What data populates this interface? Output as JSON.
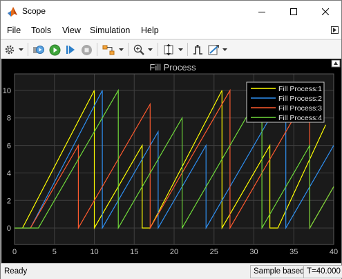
{
  "window": {
    "title": "Scope",
    "buttons": [
      "minimize",
      "maximize",
      "close"
    ]
  },
  "menu": [
    "File",
    "Tools",
    "View",
    "Simulation",
    "Help"
  ],
  "toolbar": [
    "settings-icon",
    "dropdown-icon",
    "restore-icon",
    "run-icon",
    "step-forward-icon",
    "stop-icon",
    "highlight-icon",
    "dropdown-icon",
    "zoom-icon",
    "dropdown-icon",
    "autoscale-icon",
    "dropdown-icon",
    "triggers-icon",
    "cursor-measurement-icon",
    "dropdown-icon"
  ],
  "status": {
    "left": "Ready",
    "mode": "Sample based",
    "time": "T=40.000"
  },
  "colors": {
    "background": "#000000",
    "axes": "#1a1a1a",
    "grid": "#404040",
    "text": "#c8c8c8",
    "series": [
      "#ffff00",
      "#2e8ff2",
      "#ff5a2e",
      "#6fd93a"
    ]
  },
  "chart_data": {
    "type": "line",
    "title": "Fill Process",
    "xlim": [
      0,
      40
    ],
    "ylim": [
      -1.2,
      11.2
    ],
    "xticks": [
      0,
      5,
      10,
      15,
      20,
      25,
      30,
      35,
      40
    ],
    "yticks": [
      0,
      2,
      4,
      6,
      8,
      10
    ],
    "grid": true,
    "legend_position": "top-right",
    "series": [
      {
        "name": "Fill Process:1",
        "color": "#ffff00",
        "points": [
          [
            0,
            0
          ],
          [
            1,
            0
          ],
          [
            10,
            10
          ],
          [
            10,
            0
          ],
          [
            16,
            6
          ],
          [
            16,
            0
          ],
          [
            17,
            0
          ],
          [
            26,
            10
          ],
          [
            26,
            0
          ],
          [
            32,
            6
          ],
          [
            32,
            0
          ],
          [
            33,
            0
          ],
          [
            39,
            7.5
          ]
        ]
      },
      {
        "name": "Fill Process:2",
        "color": "#2e8ff2",
        "points": [
          [
            0,
            0
          ],
          [
            2,
            0
          ],
          [
            11,
            10
          ],
          [
            11,
            0
          ],
          [
            18,
            7
          ],
          [
            18,
            0
          ],
          [
            24,
            6
          ],
          [
            24,
            0
          ],
          [
            34,
            10
          ],
          [
            34,
            0
          ],
          [
            40,
            6
          ]
        ]
      },
      {
        "name": "Fill Process:3",
        "color": "#ff5a2e",
        "points": [
          [
            0,
            0
          ],
          [
            2,
            0
          ],
          [
            8,
            6
          ],
          [
            8,
            0
          ],
          [
            17,
            9
          ],
          [
            17,
            0
          ],
          [
            27,
            10
          ],
          [
            27,
            0
          ],
          [
            37,
            10
          ],
          [
            37,
            0
          ],
          [
            40,
            3
          ]
        ]
      },
      {
        "name": "Fill Process:4",
        "color": "#6fd93a",
        "points": [
          [
            0,
            0
          ],
          [
            3,
            0
          ],
          [
            13,
            10
          ],
          [
            13,
            0
          ],
          [
            21,
            8
          ],
          [
            21,
            0
          ],
          [
            31,
            10
          ],
          [
            31,
            0
          ],
          [
            37,
            6
          ],
          [
            37,
            0
          ],
          [
            40,
            3
          ]
        ]
      }
    ]
  }
}
